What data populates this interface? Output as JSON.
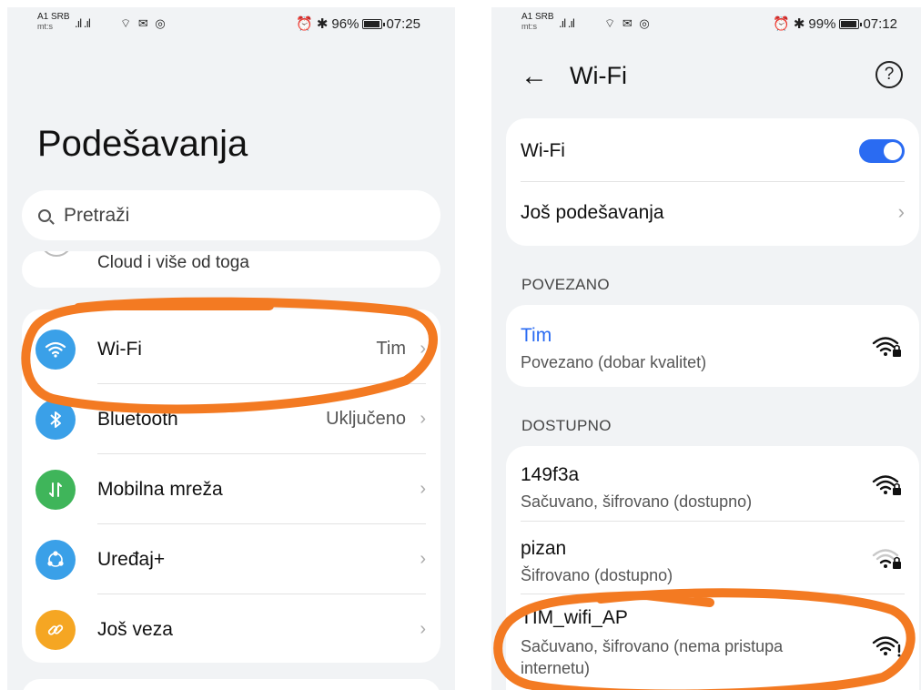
{
  "left": {
    "status": {
      "carrier": "A1 SRB",
      "carrier_sub": "mt:s",
      "signal": ".ıl .ıl",
      "icons": "⌔ ✉ ◎",
      "right_icons": "⏰ ✱",
      "battery": "96%",
      "battery_level": 0.96,
      "time": "07:25"
    },
    "title": "Podešavanja",
    "search_placeholder": "Pretraži",
    "cloud_text": "Cloud i više od toga",
    "rows": [
      {
        "label": "Wi-Fi",
        "value": "Tim",
        "icon": "wifi-icon",
        "color": "#3aa0e8"
      },
      {
        "label": "Bluetooth",
        "value": "Uključeno",
        "icon": "bluetooth-icon",
        "color": "#3aa0e8"
      },
      {
        "label": "Mobilna mreža",
        "value": "",
        "icon": "mobile-network-icon",
        "color": "#3fb55a"
      },
      {
        "label": "Uređaj+",
        "value": "",
        "icon": "device-plus-icon",
        "color": "#3aa0e8"
      },
      {
        "label": "Još veza",
        "value": "",
        "icon": "link-icon",
        "color": "#f5a623"
      }
    ]
  },
  "right": {
    "status": {
      "carrier": "A1 SRB",
      "carrier_sub": "mt:s",
      "signal": ".ıl .ıl",
      "icons": "⌔ ✉ ◎",
      "right_icons": "⏰ ✱",
      "battery": "99%",
      "battery_level": 0.99,
      "time": "07:12"
    },
    "title": "Wi-Fi",
    "help": "?",
    "toggle_label": "Wi-Fi",
    "toggle_on": true,
    "more_settings": "Još podešavanja",
    "connected_header": "POVEZANO",
    "connected": {
      "name": "Tim",
      "status": "Povezano (dobar kvalitet)",
      "signal": "strong",
      "locked": true
    },
    "available_header": "DOSTUPNO",
    "available": [
      {
        "name": "149f3a",
        "status": "Sačuvano, šifrovano (dostupno)",
        "signal": "strong",
        "locked": true
      },
      {
        "name": "pizan",
        "status": "Šifrovano (dostupno)",
        "signal": "weak",
        "locked": true
      },
      {
        "name": "TIM_wifi_AP",
        "status_line1": "Sačuvano, šifrovano (nema pristupa",
        "status_line2": "internetu)",
        "signal": "no-internet",
        "locked": false
      }
    ]
  },
  "colors": {
    "annotation": "#f37a22",
    "accent": "#2a6bf2",
    "connected_name": "#2a6bf2"
  }
}
